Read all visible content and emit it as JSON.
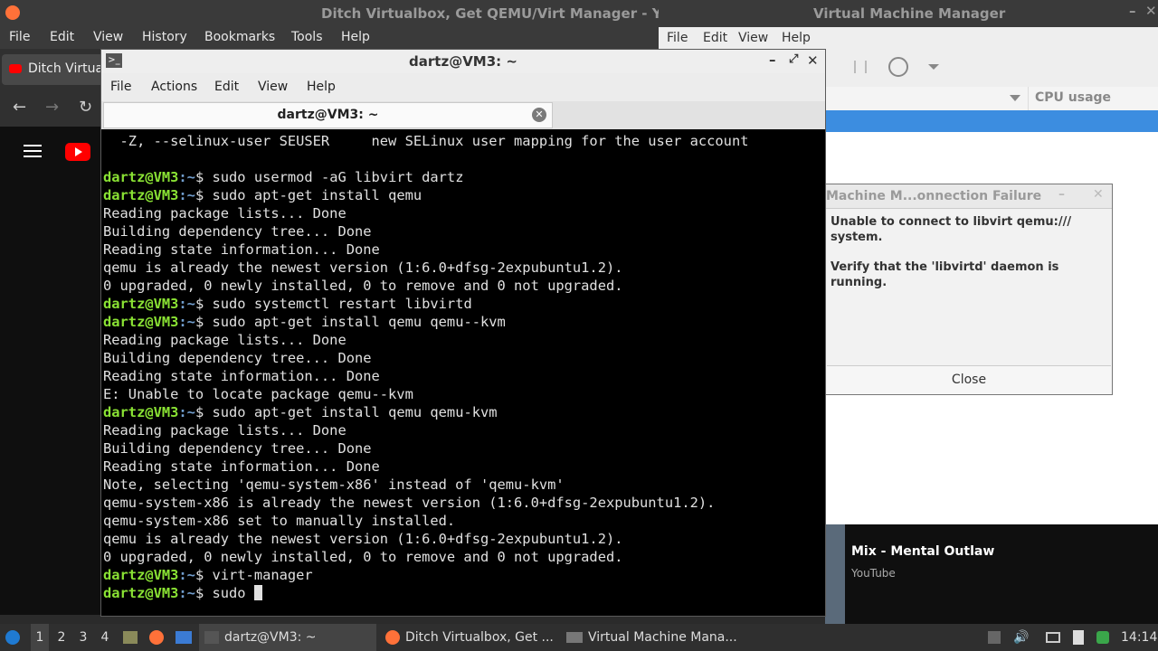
{
  "firefox": {
    "window_title": "Ditch Virtualbox, Get QEMU/Virt Manager - Yo",
    "menu": [
      "File",
      "Edit",
      "View",
      "History",
      "Bookmarks",
      "Tools",
      "Help"
    ],
    "tab_title": "Ditch Virtua"
  },
  "virt_manager": {
    "window_title": "Virtual Machine Manager",
    "menu": [
      "File",
      "Edit",
      "View",
      "Help"
    ],
    "column_header": "CPU usage",
    "dialog": {
      "title": "Machine M...onnection Failure",
      "message_1": "Unable to connect to libvirt qemu:/// system.",
      "message_2": "Verify that the 'libvirtd' daemon is running.",
      "close_label": "Close"
    }
  },
  "youtube_mini": {
    "title": "Mix - Mental Outlaw",
    "subtitle": "YouTube"
  },
  "terminal": {
    "window_title": "dartz@VM3: ~",
    "menu": [
      "File",
      "Actions",
      "Edit",
      "View",
      "Help"
    ],
    "tab_title": "dartz@VM3: ~",
    "prompt_user": "dartz@VM3",
    "prompt_path": ":~",
    "lines": [
      {
        "type": "out",
        "text": "  -Z, --selinux-user SEUSER     new SELinux user mapping for the user account"
      },
      {
        "type": "out",
        "text": ""
      },
      {
        "type": "cmd",
        "text": "$ sudo usermod -aG libvirt dartz"
      },
      {
        "type": "cmd",
        "text": "$ sudo apt-get install qemu"
      },
      {
        "type": "out",
        "text": "Reading package lists... Done"
      },
      {
        "type": "out",
        "text": "Building dependency tree... Done"
      },
      {
        "type": "out",
        "text": "Reading state information... Done"
      },
      {
        "type": "out",
        "text": "qemu is already the newest version (1:6.0+dfsg-2expubuntu1.2)."
      },
      {
        "type": "out",
        "text": "0 upgraded, 0 newly installed, 0 to remove and 0 not upgraded."
      },
      {
        "type": "cmd",
        "text": "$ sudo systemctl restart libvirtd"
      },
      {
        "type": "cmd",
        "text": "$ sudo apt-get install qemu qemu--kvm"
      },
      {
        "type": "out",
        "text": "Reading package lists... Done"
      },
      {
        "type": "out",
        "text": "Building dependency tree... Done"
      },
      {
        "type": "out",
        "text": "Reading state information... Done"
      },
      {
        "type": "out",
        "text": "E: Unable to locate package qemu--kvm"
      },
      {
        "type": "cmd",
        "text": "$ sudo apt-get install qemu qemu-kvm"
      },
      {
        "type": "out",
        "text": "Reading package lists... Done"
      },
      {
        "type": "out",
        "text": "Building dependency tree... Done"
      },
      {
        "type": "out",
        "text": "Reading state information... Done"
      },
      {
        "type": "out",
        "text": "Note, selecting 'qemu-system-x86' instead of 'qemu-kvm'"
      },
      {
        "type": "out",
        "text": "qemu-system-x86 is already the newest version (1:6.0+dfsg-2expubuntu1.2)."
      },
      {
        "type": "out",
        "text": "qemu-system-x86 set to manually installed."
      },
      {
        "type": "out",
        "text": "qemu is already the newest version (1:6.0+dfsg-2expubuntu1.2)."
      },
      {
        "type": "out",
        "text": "0 upgraded, 0 newly installed, 0 to remove and 0 not upgraded."
      },
      {
        "type": "cmd",
        "text": "$ virt-manager"
      },
      {
        "type": "cmd",
        "text": "$ sudo ",
        "cursor": true
      }
    ]
  },
  "taskbar": {
    "workspaces": [
      "1",
      "2",
      "3",
      "4"
    ],
    "tasks": [
      {
        "label": "dartz@VM3: ~",
        "icon": "terminal-icon"
      },
      {
        "label": "Ditch Virtualbox, Get ...",
        "icon": "firefox-icon"
      },
      {
        "label": "Virtual Machine Mana...",
        "icon": "virt-manager-icon"
      }
    ],
    "clock": "14:14"
  },
  "colors": {
    "prompt_user": "#8ae234",
    "prompt_path": "#729fcf",
    "selection": "#3c8de0"
  }
}
